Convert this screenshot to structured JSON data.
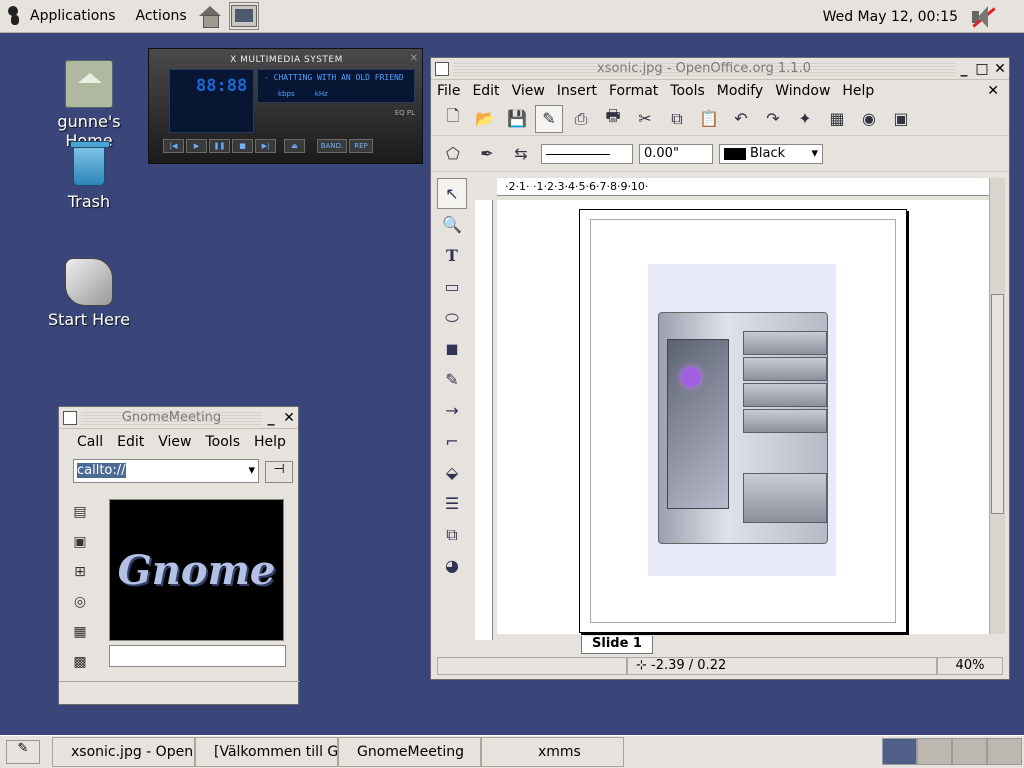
{
  "top_panel": {
    "applications": "Applications",
    "actions": "Actions",
    "clock": "Wed May 12, 00:15"
  },
  "desktop": {
    "home_label": "gunne's Home",
    "trash_label": "Trash",
    "start_label": "Start Here"
  },
  "xmms": {
    "title": "X MULTIMEDIA SYSTEM",
    "time": "88:88",
    "song": "- CHATTING WITH AN OLD FRIEND",
    "kbps": "kbps",
    "khz": "kHz",
    "eq": "EQ",
    "pl": "PL",
    "band": "BAND.",
    "rep": "REP"
  },
  "ooo": {
    "title": "xsonic.jpg - OpenOffice.org 1.1.0",
    "menus": [
      "File",
      "Edit",
      "View",
      "Insert",
      "Format",
      "Tools",
      "Modify",
      "Window",
      "Help"
    ],
    "width_value": "0.00\"",
    "color_value": "Black",
    "ruler": "·2·1·  ·1·2·3·4·5·6·7·8·9·10·",
    "slide_tab": "Slide 1",
    "coords": "-2.39 / 0.22",
    "zoom": "40%"
  },
  "gnomemeeting": {
    "title": "GnomeMeeting",
    "menus": [
      "Call",
      "Edit",
      "View",
      "Tools",
      "Help"
    ],
    "url": "callto://",
    "logo": "Gnome"
  },
  "taskbar": {
    "tasks": [
      "xsonic.jpg - OpenO",
      "[Välkommen till GC",
      "GnomeMeeting",
      "xmms"
    ]
  }
}
